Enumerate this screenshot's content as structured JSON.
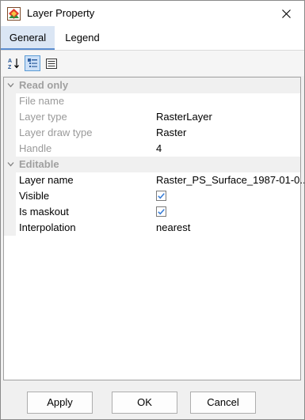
{
  "window": {
    "title": "Layer Property"
  },
  "tabs": [
    {
      "label": "General",
      "active": true
    },
    {
      "label": "Legend",
      "active": false
    }
  ],
  "toolbar": {
    "buttons": [
      {
        "icon": "sort-alphabetical-icon",
        "pressed": false
      },
      {
        "icon": "categorized-icon",
        "pressed": true
      },
      {
        "icon": "property-pages-icon",
        "pressed": false
      }
    ]
  },
  "grid": {
    "categories": [
      {
        "label": "Read only",
        "rows": [
          {
            "name": "File name",
            "value": ""
          },
          {
            "name": "Layer type",
            "value": "RasterLayer"
          },
          {
            "name": "Layer draw type",
            "value": "Raster"
          },
          {
            "name": "Handle",
            "value": "4"
          }
        ]
      },
      {
        "label": "Editable",
        "rows": [
          {
            "name": "Layer name",
            "value": "Raster_PS_Surface_1987-01-0..."
          },
          {
            "name": "Visible",
            "checked": true
          },
          {
            "name": "Is maskout",
            "checked": true
          },
          {
            "name": "Interpolation",
            "value": "nearest"
          }
        ]
      }
    ]
  },
  "buttons": {
    "apply": "Apply",
    "ok": "OK",
    "cancel": "Cancel"
  },
  "colors": {
    "accent": "#5b8dd0",
    "check": "#3b7fd8",
    "readonly_text": "#9a9a9a"
  }
}
